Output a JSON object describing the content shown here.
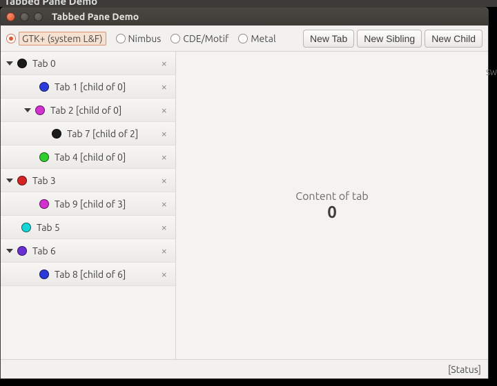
{
  "prev_window_title": "Tabbed Pane Demo",
  "window": {
    "title": "Tabbed Pane Demo"
  },
  "laf": {
    "options": [
      {
        "id": "gtk",
        "label": "GTK+ (system L&F)",
        "selected": true
      },
      {
        "id": "nimbus",
        "label": "Nimbus",
        "selected": false
      },
      {
        "id": "cde",
        "label": "CDE/Motif",
        "selected": false
      },
      {
        "id": "metal",
        "label": "Metal",
        "selected": false
      }
    ]
  },
  "buttons": {
    "new_tab": "New Tab",
    "new_sibling": "New Sibling",
    "new_child": "New Child"
  },
  "tree": [
    {
      "level": 1,
      "expandable": true,
      "color": "#1b1b1b",
      "label": "Tab 0"
    },
    {
      "level": 2,
      "expandable": false,
      "color": "#2b3bd9",
      "label": "Tab 1 [child of 0]"
    },
    {
      "level": 2,
      "expandable": true,
      "color": "#d42fd1",
      "label": "Tab 2 [child of 0]"
    },
    {
      "level": 3,
      "expandable": false,
      "color": "#1b1b1b",
      "label": "Tab 7 [child of 2]"
    },
    {
      "level": 2,
      "expandable": false,
      "color": "#2fce2f",
      "label": "Tab 4 [child of 0]"
    },
    {
      "level": 1,
      "expandable": true,
      "color": "#d52424",
      "label": "Tab 3"
    },
    {
      "level": 2,
      "expandable": false,
      "color": "#d42fd1",
      "label": "Tab 9 [child of 3]"
    },
    {
      "level": 1,
      "expandable": false,
      "color": "#17d6d6",
      "label": "Tab 5"
    },
    {
      "level": 1,
      "expandable": true,
      "color": "#6a2fd1",
      "label": "Tab 6"
    },
    {
      "level": 2,
      "expandable": false,
      "color": "#2b3bd9",
      "label": "Tab 8 [child of 6]"
    }
  ],
  "content": {
    "line": "Content of tab",
    "current": "0"
  },
  "status": "[Status]",
  "debris": "SW"
}
